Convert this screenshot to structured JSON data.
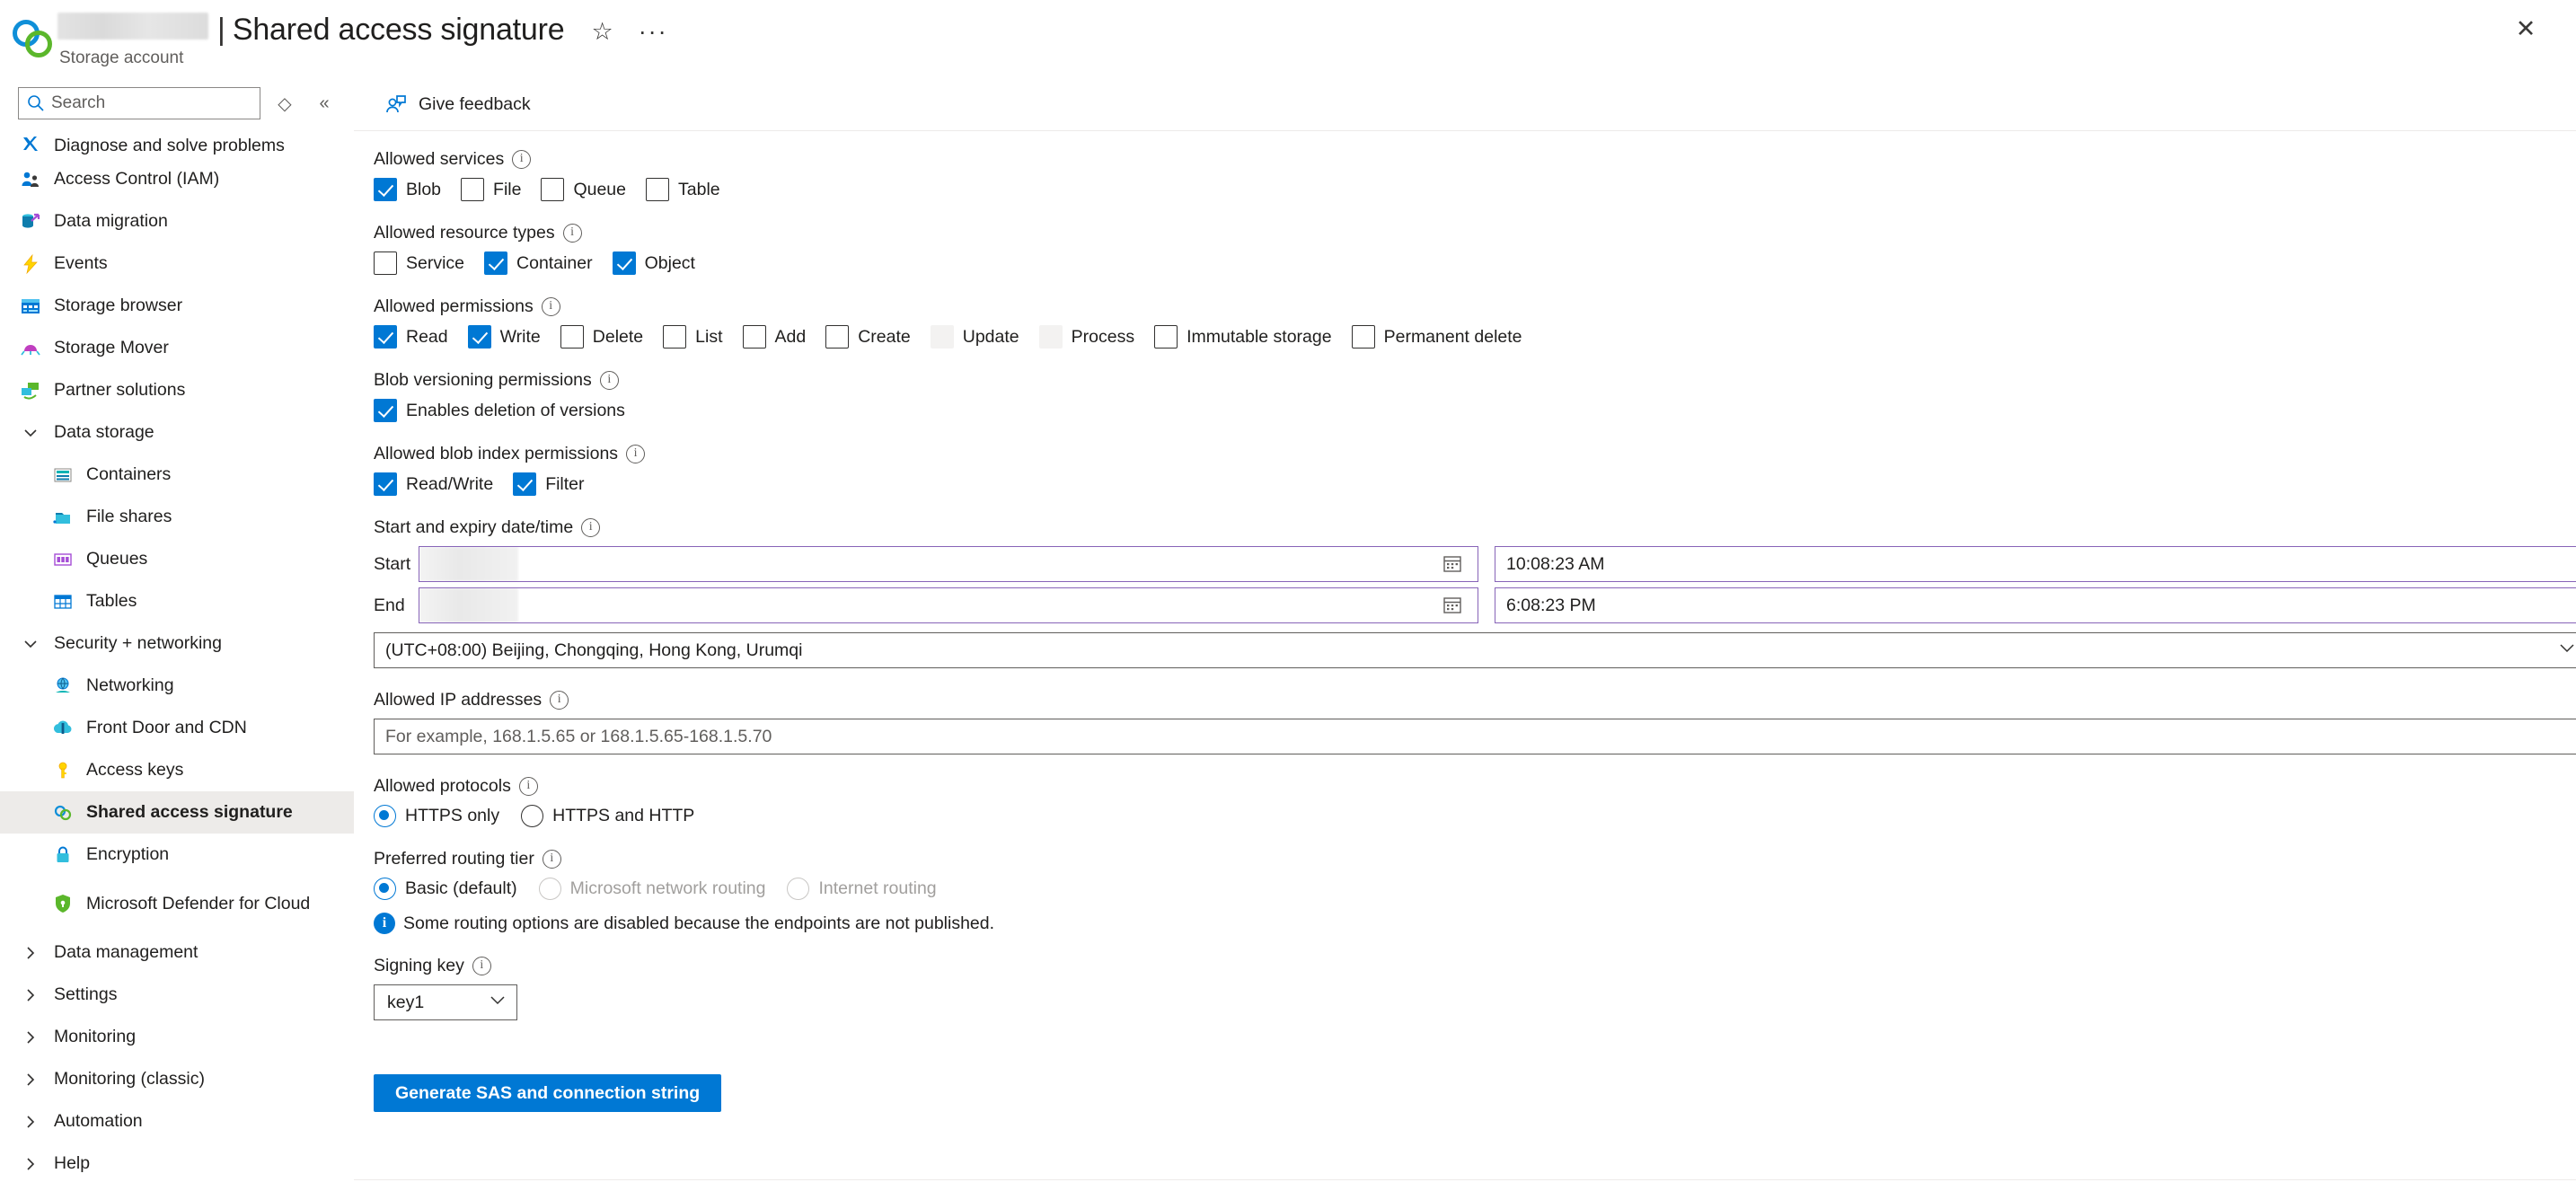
{
  "header": {
    "account_name_redacted": "",
    "separator": "|",
    "page_title": "Shared access signature",
    "subtitle": "Storage account",
    "favorite_icon": "star-icon",
    "more_icon": "ellipsis-icon",
    "close_icon": "close-icon"
  },
  "sidebar": {
    "search": {
      "placeholder": "Search",
      "icon": "search-icon"
    },
    "sort_icon": "sort-icon",
    "collapse_icon": "collapse-icon",
    "items": [
      {
        "label": "Diagnose and solve problems",
        "icon": "diagnose-icon",
        "type": "item",
        "clipped": true
      },
      {
        "label": "Access Control (IAM)",
        "icon": "access-control-icon",
        "type": "item"
      },
      {
        "label": "Data migration",
        "icon": "data-migration-icon",
        "type": "item"
      },
      {
        "label": "Events",
        "icon": "events-icon",
        "type": "item"
      },
      {
        "label": "Storage browser",
        "icon": "storage-browser-icon",
        "type": "item"
      },
      {
        "label": "Storage Mover",
        "icon": "storage-mover-icon",
        "type": "item"
      },
      {
        "label": "Partner solutions",
        "icon": "partner-solutions-icon",
        "type": "item"
      },
      {
        "label": "Data storage",
        "icon": "chevron-down-icon",
        "type": "group",
        "expanded": true
      },
      {
        "label": "Containers",
        "icon": "containers-icon",
        "type": "child"
      },
      {
        "label": "File shares",
        "icon": "file-shares-icon",
        "type": "child"
      },
      {
        "label": "Queues",
        "icon": "queues-icon",
        "type": "child"
      },
      {
        "label": "Tables",
        "icon": "tables-icon",
        "type": "child"
      },
      {
        "label": "Security + networking",
        "icon": "chevron-down-icon",
        "type": "group",
        "expanded": true
      },
      {
        "label": "Networking",
        "icon": "networking-icon",
        "type": "child"
      },
      {
        "label": "Front Door and CDN",
        "icon": "front-door-cdn-icon",
        "type": "child"
      },
      {
        "label": "Access keys",
        "icon": "access-keys-icon",
        "type": "child"
      },
      {
        "label": "Shared access signature",
        "icon": "shared-access-signature-icon",
        "type": "child",
        "selected": true
      },
      {
        "label": "Encryption",
        "icon": "encryption-icon",
        "type": "child"
      },
      {
        "label": "Microsoft Defender for Cloud",
        "icon": "defender-icon",
        "type": "child",
        "two_line": true
      },
      {
        "label": "Data management",
        "icon": "chevron-right-icon",
        "type": "group",
        "expanded": false
      },
      {
        "label": "Settings",
        "icon": "chevron-right-icon",
        "type": "group",
        "expanded": false
      },
      {
        "label": "Monitoring",
        "icon": "chevron-right-icon",
        "type": "group",
        "expanded": false
      },
      {
        "label": "Monitoring (classic)",
        "icon": "chevron-right-icon",
        "type": "group",
        "expanded": false
      },
      {
        "label": "Automation",
        "icon": "chevron-right-icon",
        "type": "group",
        "expanded": false
      },
      {
        "label": "Help",
        "icon": "chevron-right-icon",
        "type": "group",
        "expanded": false
      }
    ]
  },
  "toolbar": {
    "give_feedback_label": "Give feedback",
    "give_feedback_icon": "feedback-person-icon"
  },
  "form": {
    "allowed_services": {
      "label": "Allowed services",
      "info_icon": "info-icon",
      "options": [
        {
          "label": "Blob",
          "checked": true,
          "disabled": false
        },
        {
          "label": "File",
          "checked": false,
          "disabled": false
        },
        {
          "label": "Queue",
          "checked": false,
          "disabled": false
        },
        {
          "label": "Table",
          "checked": false,
          "disabled": false
        }
      ]
    },
    "allowed_resource_types": {
      "label": "Allowed resource types",
      "info_icon": "info-icon",
      "options": [
        {
          "label": "Service",
          "checked": false,
          "disabled": false
        },
        {
          "label": "Container",
          "checked": true,
          "disabled": false
        },
        {
          "label": "Object",
          "checked": true,
          "disabled": false
        }
      ]
    },
    "allowed_permissions": {
      "label": "Allowed permissions",
      "info_icon": "info-icon",
      "options": [
        {
          "label": "Read",
          "checked": true,
          "disabled": false
        },
        {
          "label": "Write",
          "checked": true,
          "disabled": false
        },
        {
          "label": "Delete",
          "checked": false,
          "disabled": false
        },
        {
          "label": "List",
          "checked": false,
          "disabled": false
        },
        {
          "label": "Add",
          "checked": false,
          "disabled": false
        },
        {
          "label": "Create",
          "checked": false,
          "disabled": false
        },
        {
          "label": "Update",
          "checked": false,
          "disabled": true
        },
        {
          "label": "Process",
          "checked": false,
          "disabled": true
        },
        {
          "label": "Immutable storage",
          "checked": false,
          "disabled": false
        },
        {
          "label": "Permanent delete",
          "checked": false,
          "disabled": false
        }
      ]
    },
    "blob_versioning_permissions": {
      "label": "Blob versioning permissions",
      "info_icon": "info-icon",
      "options": [
        {
          "label": "Enables deletion of versions",
          "checked": true,
          "disabled": false
        }
      ]
    },
    "allowed_blob_index_permissions": {
      "label": "Allowed blob index permissions",
      "info_icon": "info-icon",
      "options": [
        {
          "label": "Read/Write",
          "checked": true,
          "disabled": false
        },
        {
          "label": "Filter",
          "checked": true,
          "disabled": false
        }
      ]
    },
    "date_time": {
      "label": "Start and expiry date/time",
      "info_icon": "info-icon",
      "start_label": "Start",
      "end_label": "End",
      "start_date_redacted": "",
      "end_date_redacted": "",
      "start_time": "10:08:23 AM",
      "end_time": "6:08:23 PM",
      "calendar_icon": "calendar-icon",
      "timezone": "(UTC+08:00) Beijing, Chongqing, Hong Kong, Urumqi",
      "timezone_chevron": "chevron-down-icon"
    },
    "allowed_ip_addresses": {
      "label": "Allowed IP addresses",
      "info_icon": "info-icon",
      "placeholder": "For example, 168.1.5.65 or 168.1.5.65-168.1.5.70",
      "value": ""
    },
    "allowed_protocols": {
      "label": "Allowed protocols",
      "info_icon": "info-icon",
      "options": [
        {
          "label": "HTTPS only",
          "selected": true,
          "disabled": false
        },
        {
          "label": "HTTPS and HTTP",
          "selected": false,
          "disabled": false
        }
      ]
    },
    "preferred_routing_tier": {
      "label": "Preferred routing tier",
      "info_icon": "info-icon",
      "options": [
        {
          "label": "Basic (default)",
          "selected": true,
          "disabled": false
        },
        {
          "label": "Microsoft network routing",
          "selected": false,
          "disabled": true
        },
        {
          "label": "Internet routing",
          "selected": false,
          "disabled": true
        }
      ],
      "info_message": "Some routing options are disabled because the endpoints are not published.",
      "info_message_icon": "info-filled-icon"
    },
    "signing_key": {
      "label": "Signing key",
      "info_icon": "info-icon",
      "value": "key1",
      "chevron": "chevron-down-icon"
    },
    "generate_button": "Generate SAS and connection string"
  },
  "colors": {
    "accent": "#0078d4",
    "date_border": "#8764b8",
    "selected_bg": "#edebe9",
    "disabled_text": "#a19f9d"
  }
}
